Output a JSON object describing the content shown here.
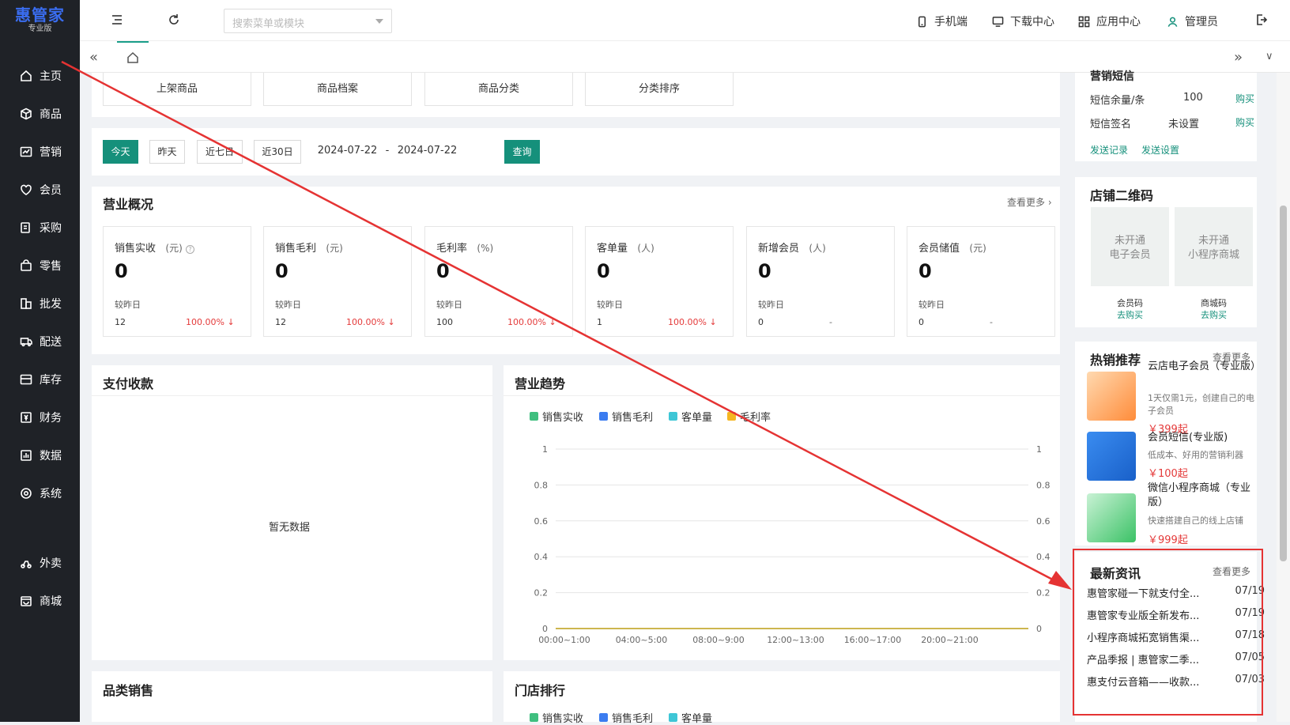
{
  "sidebar": {
    "brand": "惠管家",
    "edition": "专业版",
    "items": [
      {
        "label": "主页",
        "icon": "home-icon"
      },
      {
        "label": "商品",
        "icon": "cube-icon"
      },
      {
        "label": "营销",
        "icon": "chart-icon"
      },
      {
        "label": "会员",
        "icon": "heart-icon"
      },
      {
        "label": "采购",
        "icon": "purchase-icon"
      },
      {
        "label": "零售",
        "icon": "bag-icon"
      },
      {
        "label": "批发",
        "icon": "wholesale-icon"
      },
      {
        "label": "配送",
        "icon": "delivery-icon"
      },
      {
        "label": "库存",
        "icon": "inventory-icon"
      },
      {
        "label": "财务",
        "icon": "finance-icon"
      },
      {
        "label": "数据",
        "icon": "data-icon"
      },
      {
        "label": "系统",
        "icon": "settings-icon"
      },
      {
        "label": "外卖",
        "icon": "takeout-icon"
      },
      {
        "label": "商城",
        "icon": "mall-icon"
      }
    ]
  },
  "topbar": {
    "search_placeholder": "搜索菜单或模块",
    "mobile": "手机端",
    "download": "下载中心",
    "apps": "应用中心",
    "user": "管理员"
  },
  "quick_links": [
    "上架商品",
    "商品档案",
    "商品分类",
    "分类排序"
  ],
  "date_filter": {
    "buttons": [
      "今天",
      "昨天",
      "近七日",
      "近30日"
    ],
    "start": "2024-07-22",
    "end": "2024-07-22",
    "separator": "-",
    "query": "查询"
  },
  "overview": {
    "title": "营业概况",
    "more": "查看更多",
    "stats": [
      {
        "label": "销售实收",
        "unit": "(元)",
        "value": "0",
        "cmp": "较昨日",
        "prev": "12",
        "pct": "100.00% ↓"
      },
      {
        "label": "销售毛利",
        "unit": "(元)",
        "value": "0",
        "cmp": "较昨日",
        "prev": "12",
        "pct": "100.00% ↓"
      },
      {
        "label": "毛利率",
        "unit": "(%)",
        "value": "0",
        "cmp": "较昨日",
        "prev": "100",
        "pct": "100.00% ↓"
      },
      {
        "label": "客单量",
        "unit": "(人)",
        "value": "0",
        "cmp": "较昨日",
        "prev": "1",
        "pct": "100.00% ↓"
      },
      {
        "label": "新增会员",
        "unit": "(人)",
        "value": "0",
        "cmp": "较昨日",
        "prev": "0",
        "pct": "-"
      },
      {
        "label": "会员储值",
        "unit": "(元)",
        "value": "0",
        "cmp": "较昨日",
        "prev": "0",
        "pct": "-"
      }
    ]
  },
  "payment": {
    "title": "支付收款",
    "empty": "暂无数据"
  },
  "trend": {
    "title": "营业趋势"
  },
  "category_sales": {
    "title": "品类销售"
  },
  "store_rank": {
    "title": "门店排行",
    "legend": [
      "销售实收",
      "销售毛利",
      "客单量"
    ]
  },
  "chart_data": {
    "type": "line",
    "x": [
      "00:00~1:00",
      "04:00~5:00",
      "08:00~9:00",
      "12:00~13:00",
      "16:00~17:00",
      "20:00~21:00"
    ],
    "series": [
      {
        "name": "销售实收",
        "color": "#3fbf7f",
        "values": [
          0,
          0,
          0,
          0,
          0,
          0
        ]
      },
      {
        "name": "销售毛利",
        "color": "#3b7cf0",
        "values": [
          0,
          0,
          0,
          0,
          0,
          0
        ]
      },
      {
        "name": "客单量",
        "color": "#3ec6d6",
        "values": [
          0,
          0,
          0,
          0,
          0,
          0
        ]
      },
      {
        "name": "毛利率",
        "color": "#f5b622",
        "values": [
          0,
          0,
          0,
          0,
          0,
          0
        ]
      }
    ],
    "y_ticks": [
      "0",
      "0.2",
      "0.4",
      "0.6",
      "0.8",
      "1"
    ],
    "ylim": [
      0,
      1
    ]
  },
  "sms": {
    "title": "营销短信",
    "balance_label": "短信余量/条",
    "balance_value": "100",
    "buy1": "购买",
    "sign_label": "短信签名",
    "sign_value": "未设置",
    "buy2": "购买",
    "record": "发送记录",
    "settings": "发送设置"
  },
  "qrcode": {
    "title": "店铺二维码",
    "items": [
      {
        "text1": "未开通",
        "text2": "电子会员",
        "label": "会员码",
        "action": "去购买"
      },
      {
        "text1": "未开通",
        "text2": "小程序商城",
        "label": "商城码",
        "action": "去购买"
      }
    ]
  },
  "hot": {
    "title": "热销推荐",
    "more": "查看更多",
    "items": [
      {
        "name": "云店电子会员（专业版）",
        "desc": "1天仅需1元，创建自己的电子会员",
        "price": "￥399起"
      },
      {
        "name": "会员短信(专业版)",
        "desc": "低成本、好用的营销利器",
        "price": "￥100起"
      },
      {
        "name": "微信小程序商城（专业版）",
        "desc": "快速搭建自己的线上店铺",
        "price": "￥999起"
      }
    ]
  },
  "news": {
    "title": "最新资讯",
    "more": "查看更多",
    "items": [
      {
        "title": "惠管家碰一下就支付全...",
        "date": "07/19"
      },
      {
        "title": "惠管家专业版全新发布...",
        "date": "07/19"
      },
      {
        "title": "小程序商城拓宽销售渠...",
        "date": "07/18"
      },
      {
        "title": "产品季报 | 惠管家二季...",
        "date": "07/05"
      },
      {
        "title": "惠支付云音箱——收款...",
        "date": "07/03"
      }
    ]
  },
  "colors": {
    "accent": "#15907b",
    "annotation": "#e53333",
    "down": "#e43a3a"
  }
}
